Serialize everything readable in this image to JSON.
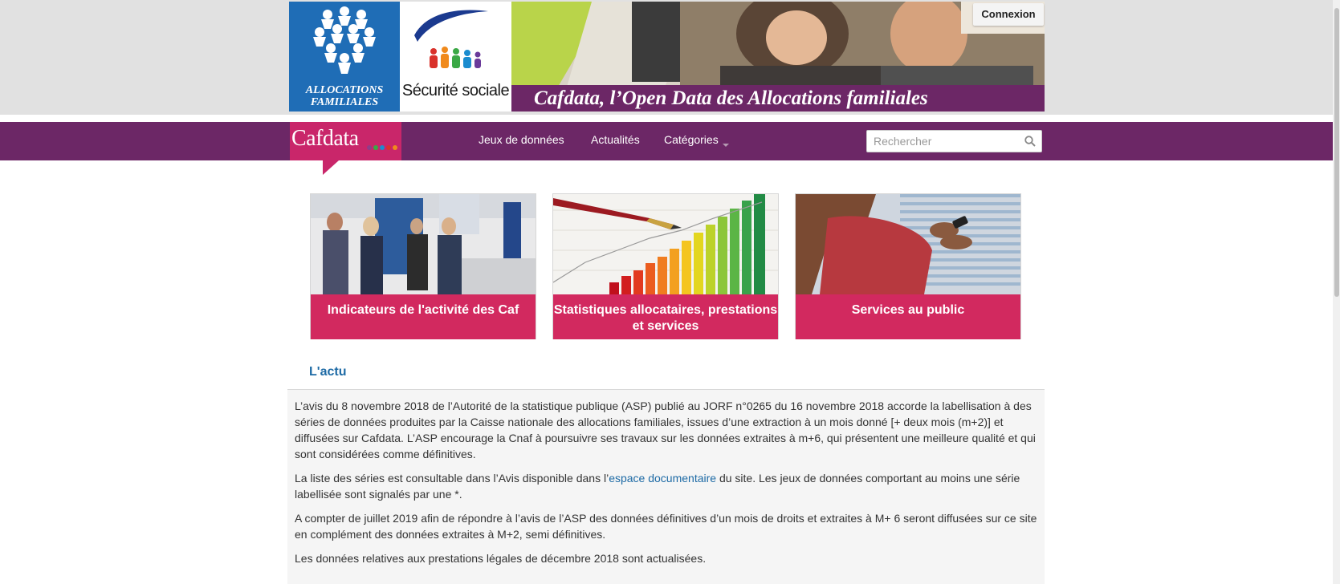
{
  "header": {
    "caf_logo_text_line1": "ALLOCATIONS",
    "caf_logo_text_line2": "FAMILIALES",
    "ss_logo_text": "Sécurité sociale",
    "banner_title": "Cafdata, l’Open Data des Allocations familiales",
    "connexion_label": "Connexion"
  },
  "nav": {
    "brand": "Cafdata",
    "items": [
      {
        "label": "Jeux de données"
      },
      {
        "label": "Actualités"
      },
      {
        "label": "Catégories"
      }
    ],
    "search_placeholder": "Rechercher"
  },
  "cards": [
    {
      "label": "Indicateurs de l'activité des Caf"
    },
    {
      "label": "Statistiques allocataires, prestations et services"
    },
    {
      "label": "Services au public"
    }
  ],
  "actu": {
    "title": "L'actu",
    "p1": "L’avis du 8 novembre 2018 de l’Autorité de la statistique publique (ASP) publié au JORF n°0265 du 16 novembre 2018 accorde la labellisation à des séries de données produites par la Caisse nationale des allocations familiales, issues d’une extraction à un mois donné [+ deux mois (m+2)] et diffusées sur Cafdata. L’ASP encourage la Cnaf à poursuivre ses travaux sur les données extraites à m+6, qui présentent une meilleure qualité et qui sont considérées comme définitives.",
    "p2_before": "La liste des séries est consultable dans l’Avis disponible dans l’",
    "p2_link": "espace documentaire",
    "p2_after": " du site. Les jeux de données comportant au moins une série labellisée sont signalés par une *.",
    "p3": "A compter de juillet 2019 afin de répondre à l’avis de l’ASP des données définitives d’un mois de droits et extraites à M+ 6 seront diffusées sur ce site en complément des données extraites à M+2, semi définitives.",
    "p4": "Les données relatives aux prestations légales de décembre 2018 sont actualisées."
  },
  "colors": {
    "purple": "#6c2766",
    "pink": "#d2295f",
    "caf_blue": "#1f6db6",
    "link": "#1d6aa5"
  }
}
